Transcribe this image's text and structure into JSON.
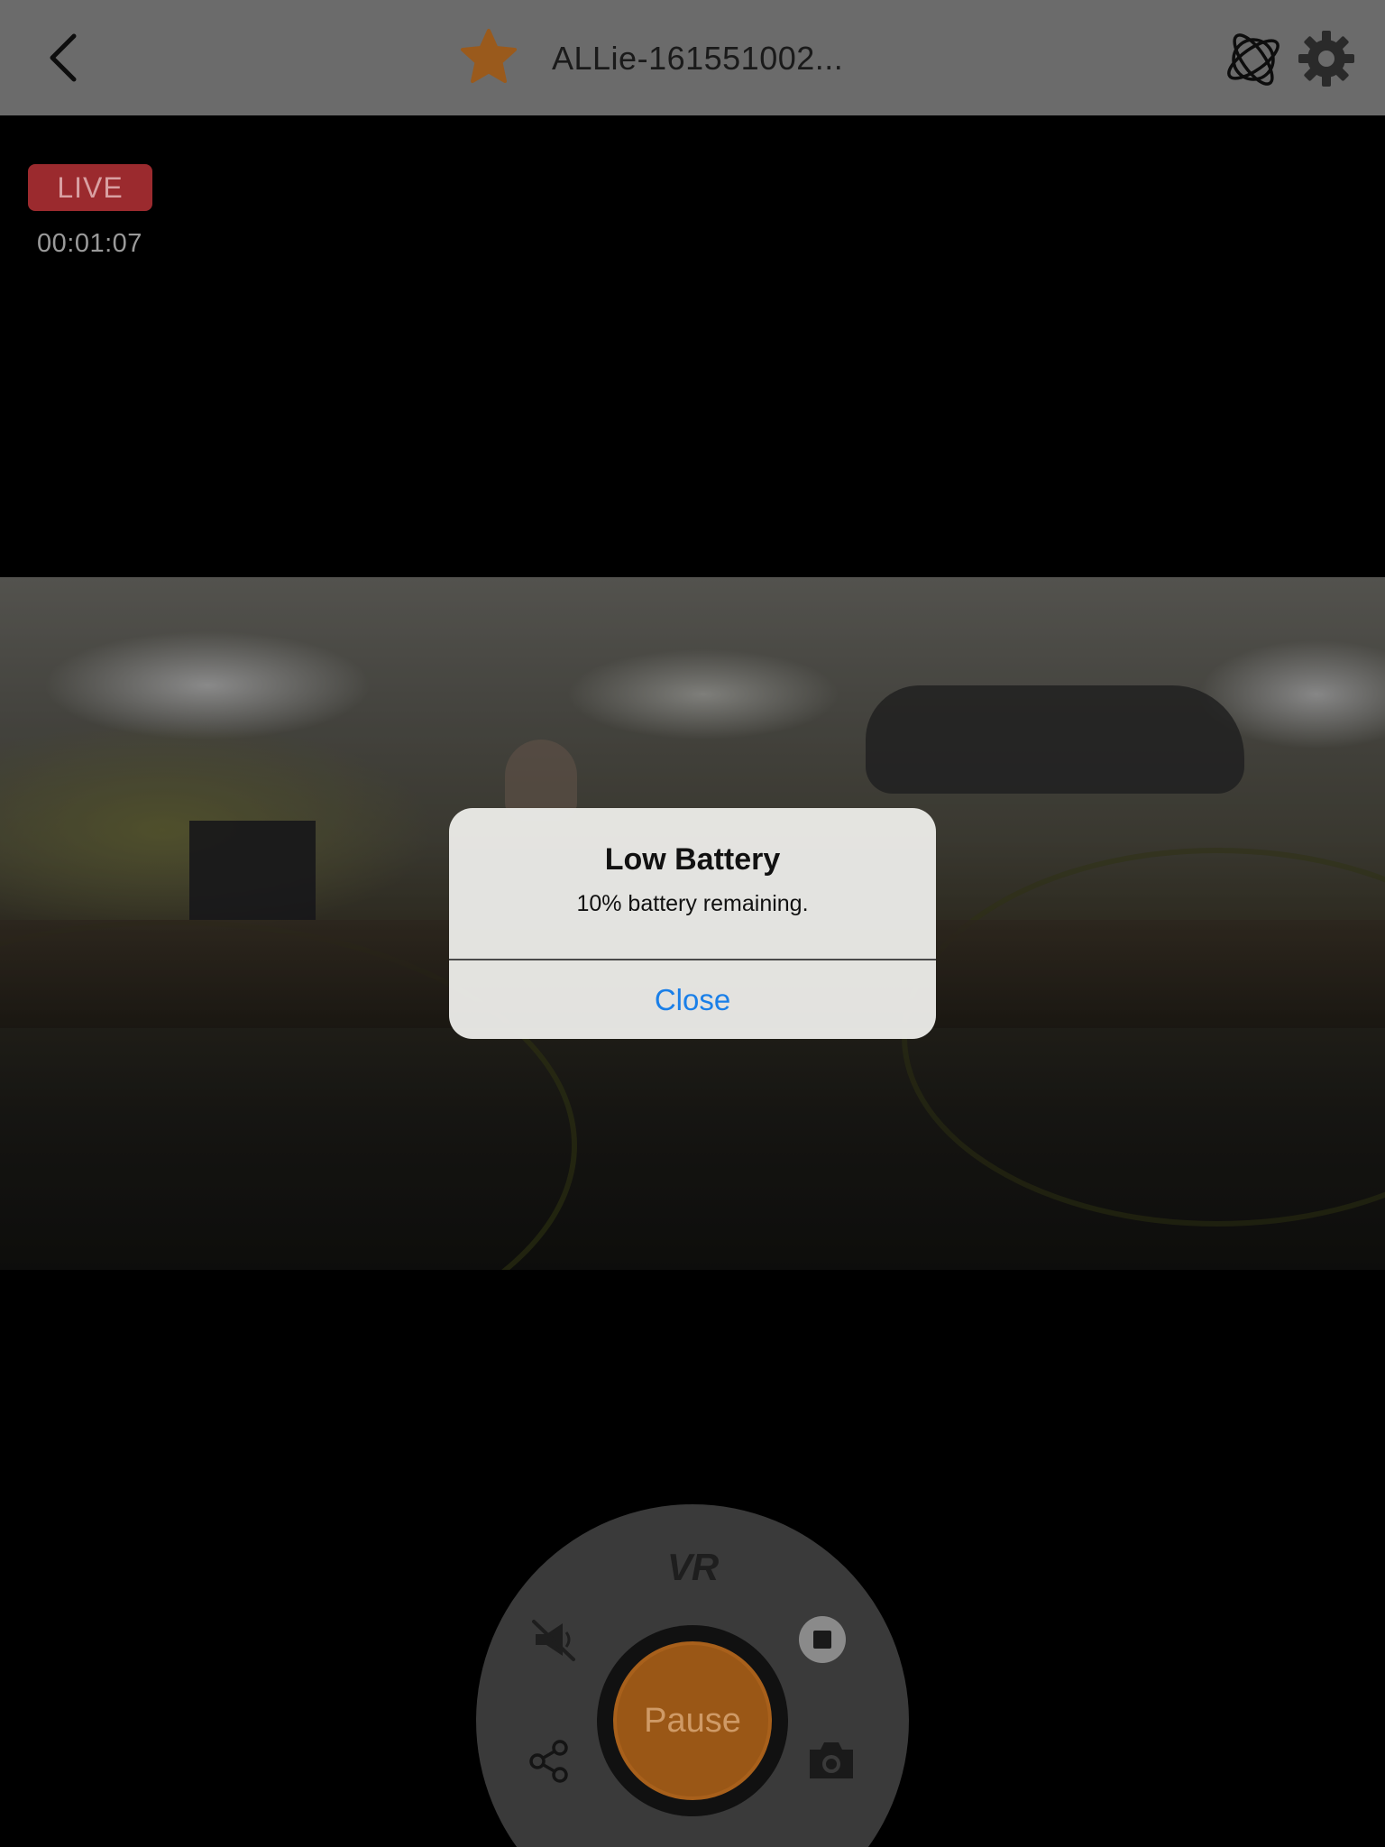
{
  "header": {
    "title": "ALLie-161551002...",
    "back_icon": "chevron-left-icon",
    "favorite_icon": "star-icon",
    "orbit_icon": "orbit-icon",
    "settings_icon": "gear-icon",
    "favorite_color": "#9a5a1c"
  },
  "status": {
    "live_label": "LIVE",
    "elapsed": "00:01:07",
    "live_color": "#9b2a2e"
  },
  "controls": {
    "mode_label": "VR",
    "pause_label": "Pause",
    "mute_icon": "megaphone-muted-icon",
    "stop_icon": "stop-icon",
    "share_icon": "share-icon",
    "camera_icon": "camera-icon",
    "pause_color": "#9a5716"
  },
  "alert": {
    "title": "Low Battery",
    "message": "10% battery remaining.",
    "close_label": "Close",
    "button_color": "#1a7fe8"
  }
}
